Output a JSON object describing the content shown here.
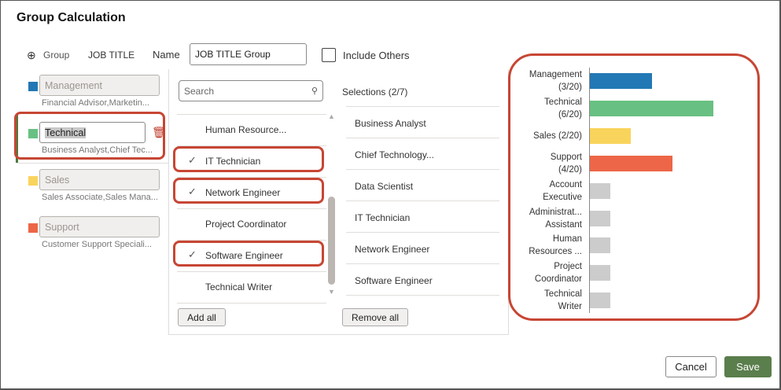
{
  "dialog": {
    "title": "Group Calculation"
  },
  "toolbar": {
    "add_group": "Group",
    "column": "JOB TITLE",
    "name_label": "Name",
    "name_value": "JOB TITLE Group",
    "include_others": "Include Others"
  },
  "groups": [
    {
      "name": "Management",
      "members": "Financial Advisor,Marketin...",
      "color": "#2278b4"
    },
    {
      "name": "Technical",
      "members": "Business Analyst,Chief Tec...",
      "color": "#68c182"
    },
    {
      "name": "Sales",
      "members": "Sales Associate,Sales Mana...",
      "color": "#f9d45c"
    },
    {
      "name": "Support",
      "members": "Customer Support Speciali...",
      "color": "#ed6647"
    }
  ],
  "available": {
    "search_placeholder": "Search",
    "items": [
      {
        "label": "Human Resource...",
        "checked": false
      },
      {
        "label": "IT Technician",
        "checked": true
      },
      {
        "label": "Network Engineer",
        "checked": true
      },
      {
        "label": "Project Coordinator",
        "checked": false
      },
      {
        "label": "Software Engineer",
        "checked": true
      },
      {
        "label": "Technical Writer",
        "checked": false
      }
    ],
    "add_all": "Add all",
    "check_glyph": "✓"
  },
  "selections": {
    "header": "Selections (2/7)",
    "items": [
      "Business Analyst",
      "Chief Technology...",
      "Data Scientist",
      "IT Technician",
      "Network Engineer",
      "Software Engineer"
    ],
    "remove_all": "Remove all"
  },
  "chart_data": {
    "type": "bar",
    "orientation": "horizontal",
    "categories": [
      [
        "Management",
        "(3/20)"
      ],
      [
        "Technical",
        "(6/20)"
      ],
      [
        "Sales (2/20)"
      ],
      [
        "Support",
        "(4/20)"
      ],
      [
        "Account",
        "Executive"
      ],
      [
        "Administrat...",
        "Assistant"
      ],
      [
        "Human",
        "Resources ..."
      ],
      [
        "Project",
        "Coordinator"
      ],
      [
        "Technical",
        "Writer"
      ]
    ],
    "values": [
      3,
      6,
      2,
      4,
      1,
      1,
      1,
      1,
      1
    ],
    "colors": [
      "#2278b4",
      "#68c182",
      "#f9d45c",
      "#ed6647",
      "#cccccc",
      "#cccccc",
      "#cccccc",
      "#cccccc",
      "#cccccc"
    ]
  },
  "footer": {
    "cancel": "Cancel",
    "save": "Save"
  }
}
